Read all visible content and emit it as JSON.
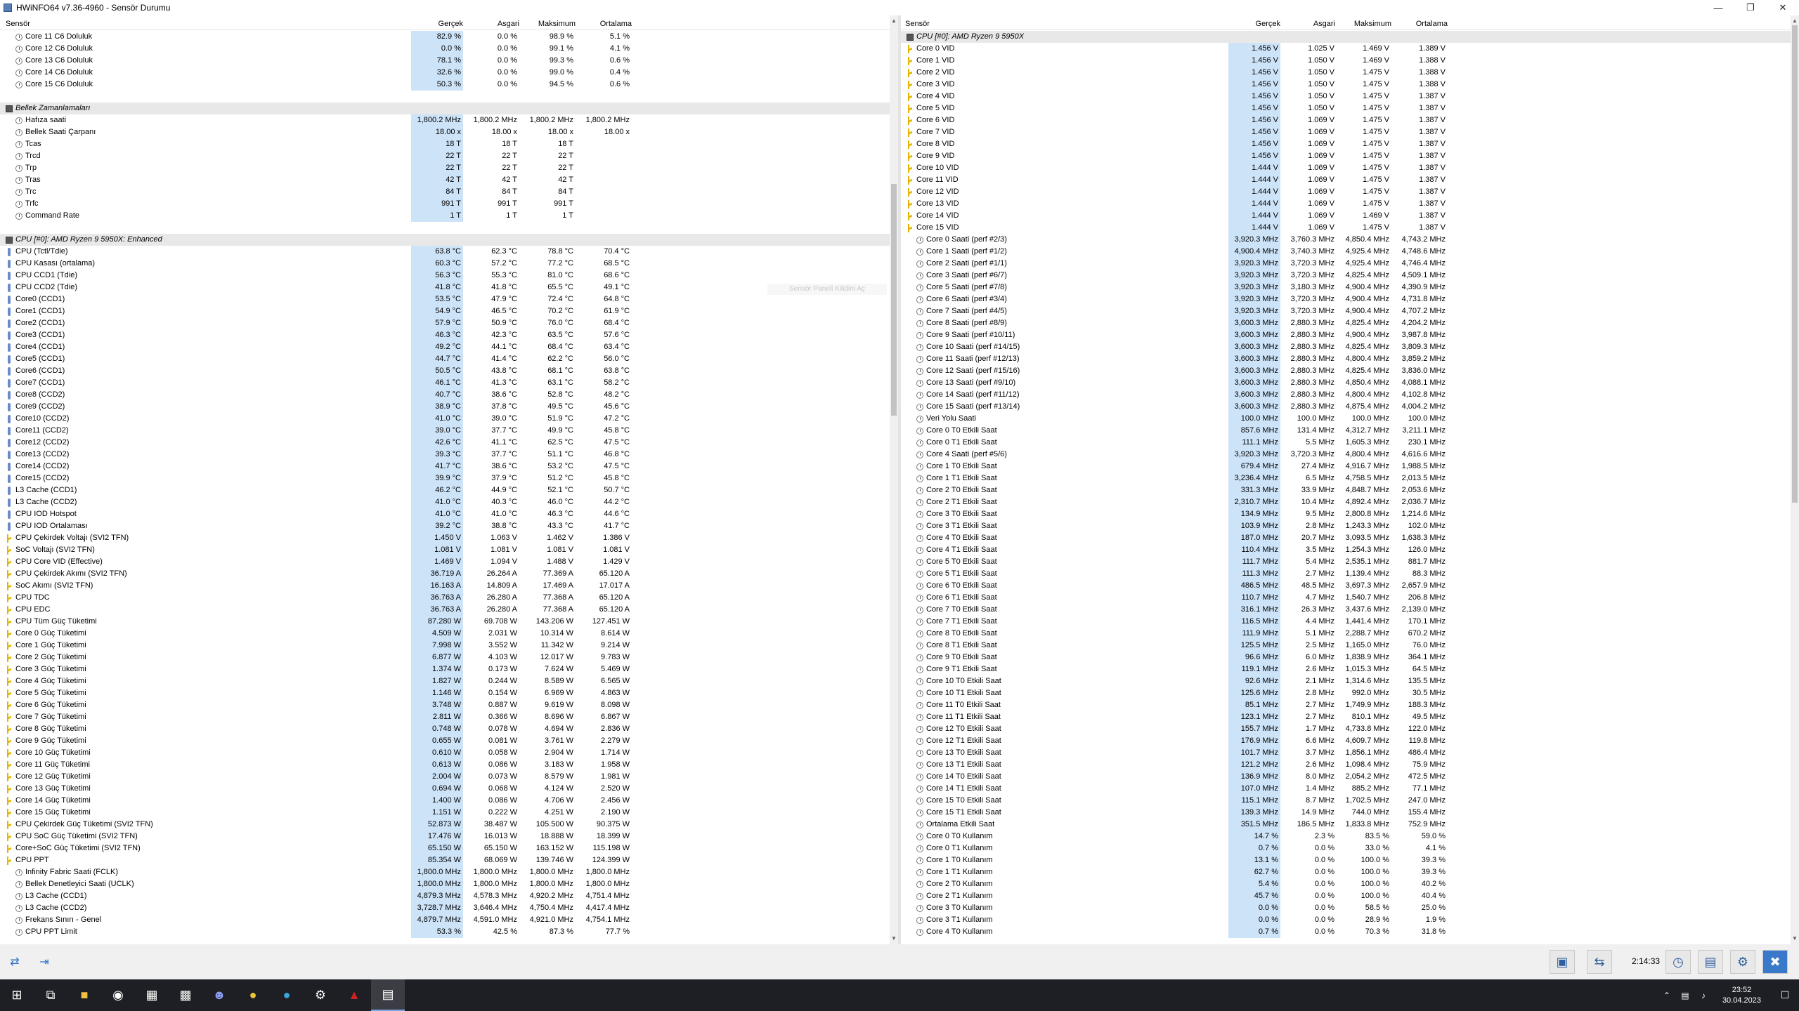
{
  "window": {
    "title": "HWiNFO64 v7.36-4960 - Sensör Durumu"
  },
  "columns": {
    "sensor": "Sensör",
    "current": "Gerçek",
    "min": "Asgari",
    "max": "Maksimum",
    "avg": "Ortalama"
  },
  "left_rows": [
    [
      "s",
      "Core 11 C6 Doluluk",
      "82.9 %",
      "0.0 %",
      "98.9 %",
      "5.1 %"
    ],
    [
      "s",
      "Core 12 C6 Doluluk",
      "0.0 %",
      "0.0 %",
      "99.1 %",
      "4.1 %"
    ],
    [
      "s",
      "Core 13 C6 Doluluk",
      "78.1 %",
      "0.0 %",
      "99.3 %",
      "0.6 %"
    ],
    [
      "s",
      "Core 14 C6 Doluluk",
      "32.6 %",
      "0.0 %",
      "99.0 %",
      "0.4 %"
    ],
    [
      "s",
      "Core 15 C6 Doluluk",
      "50.3 %",
      "0.0 %",
      "94.5 %",
      "0.6 %"
    ],
    [
      "gap"
    ],
    [
      "g",
      "Bellek Zamanlamaları"
    ],
    [
      "s",
      "Hafıza saati",
      "1,800.2 MHz",
      "1,800.2 MHz",
      "1,800.2 MHz",
      "1,800.2 MHz"
    ],
    [
      "s",
      "Bellek Saati Çarpanı",
      "18.00 x",
      "18.00 x",
      "18.00 x",
      "18.00 x"
    ],
    [
      "s",
      "Tcas",
      "18 T",
      "18 T",
      "18 T",
      ""
    ],
    [
      "s",
      "Trcd",
      "22 T",
      "22 T",
      "22 T",
      ""
    ],
    [
      "s",
      "Trp",
      "22 T",
      "22 T",
      "22 T",
      ""
    ],
    [
      "s",
      "Tras",
      "42 T",
      "42 T",
      "42 T",
      ""
    ],
    [
      "s",
      "Trc",
      "84 T",
      "84 T",
      "84 T",
      ""
    ],
    [
      "s",
      "Trfc",
      "991 T",
      "991 T",
      "991 T",
      ""
    ],
    [
      "s",
      "Command Rate",
      "1 T",
      "1 T",
      "1 T",
      ""
    ],
    [
      "gap"
    ],
    [
      "g",
      "CPU [#0]: AMD Ryzen 9 5950X: Enhanced"
    ],
    [
      "t",
      "CPU (Tctl/Tdie)",
      "63.8 °C",
      "62.3 °C",
      "78.8 °C",
      "70.4 °C"
    ],
    [
      "t",
      "CPU Kasası (ortalama)",
      "60.3 °C",
      "57.2 °C",
      "77.2 °C",
      "68.5 °C"
    ],
    [
      "t",
      "CPU CCD1 (Tdie)",
      "56.3 °C",
      "55.3 °C",
      "81.0 °C",
      "68.6 °C"
    ],
    [
      "t",
      "CPU CCD2 (Tdie)",
      "41.8 °C",
      "41.8 °C",
      "65.5 °C",
      "49.1 °C"
    ],
    [
      "t",
      "Core0 (CCD1)",
      "53.5 °C",
      "47.9 °C",
      "72.4 °C",
      "64.8 °C"
    ],
    [
      "t",
      "Core1 (CCD1)",
      "54.9 °C",
      "46.5 °C",
      "70.2 °C",
      "61.9 °C"
    ],
    [
      "t",
      "Core2 (CCD1)",
      "57.9 °C",
      "50.9 °C",
      "76.0 °C",
      "68.4 °C"
    ],
    [
      "t",
      "Core3 (CCD1)",
      "46.3 °C",
      "42.3 °C",
      "63.5 °C",
      "57.6 °C"
    ],
    [
      "t",
      "Core4 (CCD1)",
      "49.2 °C",
      "44.1 °C",
      "68.4 °C",
      "63.4 °C"
    ],
    [
      "t",
      "Core5 (CCD1)",
      "44.7 °C",
      "41.4 °C",
      "62.2 °C",
      "56.0 °C"
    ],
    [
      "t",
      "Core6 (CCD1)",
      "50.5 °C",
      "43.8 °C",
      "68.1 °C",
      "63.8 °C"
    ],
    [
      "t",
      "Core7 (CCD1)",
      "46.1 °C",
      "41.3 °C",
      "63.1 °C",
      "58.2 °C"
    ],
    [
      "t",
      "Core8 (CCD2)",
      "40.7 °C",
      "38.6 °C",
      "52.8 °C",
      "48.2 °C"
    ],
    [
      "t",
      "Core9 (CCD2)",
      "38.9 °C",
      "37.8 °C",
      "49.5 °C",
      "45.6 °C"
    ],
    [
      "t",
      "Core10 (CCD2)",
      "41.0 °C",
      "39.0 °C",
      "51.9 °C",
      "47.2 °C"
    ],
    [
      "t",
      "Core11 (CCD2)",
      "39.0 °C",
      "37.7 °C",
      "49.9 °C",
      "45.8 °C"
    ],
    [
      "t",
      "Core12 (CCD2)",
      "42.6 °C",
      "41.1 °C",
      "62.5 °C",
      "47.5 °C"
    ],
    [
      "t",
      "Core13 (CCD2)",
      "39.3 °C",
      "37.7 °C",
      "51.1 °C",
      "46.8 °C"
    ],
    [
      "t",
      "Core14 (CCD2)",
      "41.7 °C",
      "38.6 °C",
      "53.2 °C",
      "47.5 °C"
    ],
    [
      "t",
      "Core15 (CCD2)",
      "39.9 °C",
      "37.9 °C",
      "51.2 °C",
      "45.8 °C"
    ],
    [
      "t",
      "L3 Cache (CCD1)",
      "46.2 °C",
      "44.9 °C",
      "52.1 °C",
      "50.7 °C"
    ],
    [
      "t",
      "L3 Cache (CCD2)",
      "41.0 °C",
      "40.3 °C",
      "46.0 °C",
      "44.2 °C"
    ],
    [
      "t",
      "CPU IOD Hotspot",
      "41.0 °C",
      "41.0 °C",
      "46.3 °C",
      "44.6 °C"
    ],
    [
      "t",
      "CPU IOD Ortalaması",
      "39.2 °C",
      "38.8 °C",
      "43.3 °C",
      "41.7 °C"
    ],
    [
      "v",
      "CPU Çekirdek Voltajı (SVI2 TFN)",
      "1.450 V",
      "1.063 V",
      "1.462 V",
      "1.386 V"
    ],
    [
      "v",
      "SoC Voltajı (SVI2 TFN)",
      "1.081 V",
      "1.081 V",
      "1.081 V",
      "1.081 V"
    ],
    [
      "v",
      "CPU Core VID (Effective)",
      "1.469 V",
      "1.094 V",
      "1.488 V",
      "1.429 V"
    ],
    [
      "v",
      "CPU Çekirdek Akımı (SVI2 TFN)",
      "36.719 A",
      "26.264 A",
      "77.369 A",
      "65.120 A"
    ],
    [
      "v",
      "SoC Akımı (SVI2 TFN)",
      "16.163 A",
      "14.809 A",
      "17.469 A",
      "17.017 A"
    ],
    [
      "v",
      "CPU TDC",
      "36.763 A",
      "26.280 A",
      "77.368 A",
      "65.120 A"
    ],
    [
      "v",
      "CPU EDC",
      "36.763 A",
      "26.280 A",
      "77.368 A",
      "65.120 A"
    ],
    [
      "v",
      "CPU Tüm Güç Tüketimi",
      "87.280 W",
      "69.708 W",
      "143.206 W",
      "127.451 W"
    ],
    [
      "v",
      "Core 0 Güç Tüketimi",
      "4.509 W",
      "2.031 W",
      "10.314 W",
      "8.614 W"
    ],
    [
      "v",
      "Core 1 Güç Tüketimi",
      "7.998 W",
      "3.552 W",
      "11.342 W",
      "9.214 W"
    ],
    [
      "v",
      "Core 2 Güç Tüketimi",
      "6.877 W",
      "4.103 W",
      "12.017 W",
      "9.783 W"
    ],
    [
      "v",
      "Core 3 Güç Tüketimi",
      "1.374 W",
      "0.173 W",
      "7.624 W",
      "5.469 W"
    ],
    [
      "v",
      "Core 4 Güç Tüketimi",
      "1.827 W",
      "0.244 W",
      "8.589 W",
      "6.565 W"
    ],
    [
      "v",
      "Core 5 Güç Tüketimi",
      "1.146 W",
      "0.154 W",
      "6.969 W",
      "4.863 W"
    ],
    [
      "v",
      "Core 6 Güç Tüketimi",
      "3.748 W",
      "0.887 W",
      "9.619 W",
      "8.098 W"
    ],
    [
      "v",
      "Core 7 Güç Tüketimi",
      "2.811 W",
      "0.366 W",
      "8.696 W",
      "6.867 W"
    ],
    [
      "v",
      "Core 8 Güç Tüketimi",
      "0.748 W",
      "0.078 W",
      "4.694 W",
      "2.836 W"
    ],
    [
      "v",
      "Core 9 Güç Tüketimi",
      "0.655 W",
      "0.081 W",
      "3.761 W",
      "2.279 W"
    ],
    [
      "v",
      "Core 10 Güç Tüketimi",
      "0.610 W",
      "0.058 W",
      "2.904 W",
      "1.714 W"
    ],
    [
      "v",
      "Core 11 Güç Tüketimi",
      "0.613 W",
      "0.086 W",
      "3.183 W",
      "1.958 W"
    ],
    [
      "v",
      "Core 12 Güç Tüketimi",
      "2.004 W",
      "0.073 W",
      "8.579 W",
      "1.981 W"
    ],
    [
      "v",
      "Core 13 Güç Tüketimi",
      "0.694 W",
      "0.068 W",
      "4.124 W",
      "2.520 W"
    ],
    [
      "v",
      "Core 14 Güç Tüketimi",
      "1.400 W",
      "0.086 W",
      "4.706 W",
      "2.456 W"
    ],
    [
      "v",
      "Core 15 Güç Tüketimi",
      "1.151 W",
      "0.222 W",
      "4.251 W",
      "2.190 W"
    ],
    [
      "v",
      "CPU Çekirdek Güç Tüketimi (SVI2 TFN)",
      "52.873 W",
      "38.487 W",
      "105.500 W",
      "90.375 W"
    ],
    [
      "v",
      "CPU SoC Güç Tüketimi (SVI2 TFN)",
      "17.476 W",
      "16.013 W",
      "18.888 W",
      "18.399 W"
    ],
    [
      "v",
      "Core+SoC Güç Tüketimi (SVI2 TFN)",
      "65.150 W",
      "65.150 W",
      "163.152 W",
      "115.198 W"
    ],
    [
      "v",
      "CPU PPT",
      "85.354 W",
      "68.069 W",
      "139.746 W",
      "124.399 W"
    ],
    [
      "s",
      "Infinity Fabric Saati (FCLK)",
      "1,800.0 MHz",
      "1,800.0 MHz",
      "1,800.0 MHz",
      "1,800.0 MHz"
    ],
    [
      "s",
      "Bellek Denetleyici Saati (UCLK)",
      "1,800.0 MHz",
      "1,800.0 MHz",
      "1,800.0 MHz",
      "1,800.0 MHz"
    ],
    [
      "s",
      "L3 Cache (CCD1)",
      "4,879.3 MHz",
      "4,578.3 MHz",
      "4,920.2 MHz",
      "4,751.4 MHz"
    ],
    [
      "s",
      "L3 Cache (CCD2)",
      "3,728.7 MHz",
      "3,646.4 MHz",
      "4,750.4 MHz",
      "4,417.4 MHz"
    ],
    [
      "s",
      "Frekans Sınırı - Genel",
      "4,879.7 MHz",
      "4,591.0 MHz",
      "4,921.0 MHz",
      "4,754.1 MHz"
    ],
    [
      "s",
      "CPU PPT Limit",
      "53.3 %",
      "42.5 %",
      "87.3 %",
      "77.7 %"
    ]
  ],
  "right_rows": [
    [
      "g",
      "CPU [#0]: AMD Ryzen 9 5950X"
    ],
    [
      "v",
      "Core 0 VID",
      "1.456 V",
      "1.025 V",
      "1.469 V",
      "1.389 V"
    ],
    [
      "v",
      "Core 1 VID",
      "1.456 V",
      "1.050 V",
      "1.469 V",
      "1.388 V"
    ],
    [
      "v",
      "Core 2 VID",
      "1.456 V",
      "1.050 V",
      "1.475 V",
      "1.388 V"
    ],
    [
      "v",
      "Core 3 VID",
      "1.456 V",
      "1.050 V",
      "1.475 V",
      "1.388 V"
    ],
    [
      "v",
      "Core 4 VID",
      "1.456 V",
      "1.050 V",
      "1.475 V",
      "1.387 V"
    ],
    [
      "v",
      "Core 5 VID",
      "1.456 V",
      "1.050 V",
      "1.475 V",
      "1.387 V"
    ],
    [
      "v",
      "Core 6 VID",
      "1.456 V",
      "1.069 V",
      "1.475 V",
      "1.387 V"
    ],
    [
      "v",
      "Core 7 VID",
      "1.456 V",
      "1.069 V",
      "1.475 V",
      "1.387 V"
    ],
    [
      "v",
      "Core 8 VID",
      "1.456 V",
      "1.069 V",
      "1.475 V",
      "1.387 V"
    ],
    [
      "v",
      "Core 9 VID",
      "1.456 V",
      "1.069 V",
      "1.475 V",
      "1.387 V"
    ],
    [
      "v",
      "Core 10 VID",
      "1.444 V",
      "1.069 V",
      "1.475 V",
      "1.387 V"
    ],
    [
      "v",
      "Core 11 VID",
      "1.444 V",
      "1.069 V",
      "1.475 V",
      "1.387 V"
    ],
    [
      "v",
      "Core 12 VID",
      "1.444 V",
      "1.069 V",
      "1.475 V",
      "1.387 V"
    ],
    [
      "v",
      "Core 13 VID",
      "1.444 V",
      "1.069 V",
      "1.475 V",
      "1.387 V"
    ],
    [
      "v",
      "Core 14 VID",
      "1.444 V",
      "1.069 V",
      "1.469 V",
      "1.387 V"
    ],
    [
      "v",
      "Core 15 VID",
      "1.444 V",
      "1.069 V",
      "1.475 V",
      "1.387 V"
    ],
    [
      "s",
      "Core 0 Saati (perf #2/3)",
      "3,920.3 MHz",
      "3,760.3 MHz",
      "4,850.4 MHz",
      "4,743.2 MHz"
    ],
    [
      "s",
      "Core 1 Saati (perf #1/2)",
      "4,900.4 MHz",
      "3,740.3 MHz",
      "4,925.4 MHz",
      "4,748.6 MHz"
    ],
    [
      "s",
      "Core 2 Saati (perf #1/1)",
      "3,920.3 MHz",
      "3,720.3 MHz",
      "4,925.4 MHz",
      "4,746.4 MHz"
    ],
    [
      "s",
      "Core 3 Saati (perf #6/7)",
      "3,920.3 MHz",
      "3,720.3 MHz",
      "4,825.4 MHz",
      "4,509.1 MHz"
    ],
    [
      "s",
      "Core 5 Saati (perf #7/8)",
      "3,920.3 MHz",
      "3,180.3 MHz",
      "4,900.4 MHz",
      "4,390.9 MHz"
    ],
    [
      "s",
      "Core 6 Saati (perf #3/4)",
      "3,920.3 MHz",
      "3,720.3 MHz",
      "4,900.4 MHz",
      "4,731.8 MHz"
    ],
    [
      "s",
      "Core 7 Saati (perf #4/5)",
      "3,920.3 MHz",
      "3,720.3 MHz",
      "4,900.4 MHz",
      "4,707.2 MHz"
    ],
    [
      "s",
      "Core 8 Saati (perf #8/9)",
      "3,600.3 MHz",
      "2,880.3 MHz",
      "4,825.4 MHz",
      "4,204.2 MHz"
    ],
    [
      "s",
      "Core 9 Saati (perf #10/11)",
      "3,600.3 MHz",
      "2,880.3 MHz",
      "4,900.4 MHz",
      "3,987.8 MHz"
    ],
    [
      "s",
      "Core 10 Saati (perf #14/15)",
      "3,600.3 MHz",
      "2,880.3 MHz",
      "4,825.4 MHz",
      "3,809.3 MHz"
    ],
    [
      "s",
      "Core 11 Saati (perf #12/13)",
      "3,600.3 MHz",
      "2,880.3 MHz",
      "4,800.4 MHz",
      "3,859.2 MHz"
    ],
    [
      "s",
      "Core 12 Saati (perf #15/16)",
      "3,600.3 MHz",
      "2,880.3 MHz",
      "4,825.4 MHz",
      "3,836.0 MHz"
    ],
    [
      "s",
      "Core 13 Saati (perf #9/10)",
      "3,600.3 MHz",
      "2,880.3 MHz",
      "4,850.4 MHz",
      "4,088.1 MHz"
    ],
    [
      "s",
      "Core 14 Saati (perf #11/12)",
      "3,600.3 MHz",
      "2,880.3 MHz",
      "4,800.4 MHz",
      "4,102.8 MHz"
    ],
    [
      "s",
      "Core 15 Saati (perf #13/14)",
      "3,600.3 MHz",
      "2,880.3 MHz",
      "4,875.4 MHz",
      "4,004.2 MHz"
    ],
    [
      "s",
      "Veri Yolu Saati",
      "100.0 MHz",
      "100.0 MHz",
      "100.0 MHz",
      "100.0 MHz"
    ],
    [
      "s",
      "Core 0 T0 Etkili Saat",
      "857.6 MHz",
      "131.4 MHz",
      "4,312.7 MHz",
      "3,211.1 MHz"
    ],
    [
      "s",
      "Core 0 T1 Etkili Saat",
      "111.1 MHz",
      "5.5 MHz",
      "1,605.3 MHz",
      "230.1 MHz"
    ],
    [
      "s",
      "Core 4 Saati (perf #5/6)",
      "3,920.3 MHz",
      "3,720.3 MHz",
      "4,800.4 MHz",
      "4,616.6 MHz"
    ],
    [
      "s",
      "Core 1 T0 Etkili Saat",
      "679.4 MHz",
      "27.4 MHz",
      "4,916.7 MHz",
      "1,988.5 MHz"
    ],
    [
      "s",
      "Core 1 T1 Etkili Saat",
      "3,236.4 MHz",
      "6.5 MHz",
      "4,758.5 MHz",
      "2,013.5 MHz"
    ],
    [
      "s",
      "Core 2 T0 Etkili Saat",
      "331.3 MHz",
      "33.9 MHz",
      "4,848.7 MHz",
      "2,053.6 MHz"
    ],
    [
      "s",
      "Core 2 T1 Etkili Saat",
      "2,310.7 MHz",
      "10.4 MHz",
      "4,892.4 MHz",
      "2,036.7 MHz"
    ],
    [
      "s",
      "Core 3 T0 Etkili Saat",
      "134.9 MHz",
      "9.5 MHz",
      "2,800.8 MHz",
      "1,214.6 MHz"
    ],
    [
      "s",
      "Core 3 T1 Etkili Saat",
      "103.9 MHz",
      "2.8 MHz",
      "1,243.3 MHz",
      "102.0 MHz"
    ],
    [
      "s",
      "Core 4 T0 Etkili Saat",
      "187.0 MHz",
      "20.7 MHz",
      "3,093.5 MHz",
      "1,638.3 MHz"
    ],
    [
      "s",
      "Core 4 T1 Etkili Saat",
      "110.4 MHz",
      "3.5 MHz",
      "1,254.3 MHz",
      "126.0 MHz"
    ],
    [
      "s",
      "Core 5 T0 Etkili Saat",
      "111.7 MHz",
      "5.4 MHz",
      "2,535.1 MHz",
      "881.7 MHz"
    ],
    [
      "s",
      "Core 5 T1 Etkili Saat",
      "111.3 MHz",
      "2.7 MHz",
      "1,139.4 MHz",
      "88.3 MHz"
    ],
    [
      "s",
      "Core 6 T0 Etkili Saat",
      "486.5 MHz",
      "48.5 MHz",
      "3,697.3 MHz",
      "2,657.9 MHz"
    ],
    [
      "s",
      "Core 6 T1 Etkili Saat",
      "110.7 MHz",
      "4.7 MHz",
      "1,540.7 MHz",
      "206.8 MHz"
    ],
    [
      "s",
      "Core 7 T0 Etkili Saat",
      "316.1 MHz",
      "26.3 MHz",
      "3,437.6 MHz",
      "2,139.0 MHz"
    ],
    [
      "s",
      "Core 7 T1 Etkili Saat",
      "116.5 MHz",
      "4.4 MHz",
      "1,441.4 MHz",
      "170.1 MHz"
    ],
    [
      "s",
      "Core 8 T0 Etkili Saat",
      "111.9 MHz",
      "5.1 MHz",
      "2,288.7 MHz",
      "670.2 MHz"
    ],
    [
      "s",
      "Core 8 T1 Etkili Saat",
      "125.5 MHz",
      "2.5 MHz",
      "1,165.0 MHz",
      "76.0 MHz"
    ],
    [
      "s",
      "Core 9 T0 Etkili Saat",
      "96.6 MHz",
      "6.0 MHz",
      "1,838.9 MHz",
      "364.1 MHz"
    ],
    [
      "s",
      "Core 9 T1 Etkili Saat",
      "119.1 MHz",
      "2.6 MHz",
      "1,015.3 MHz",
      "64.5 MHz"
    ],
    [
      "s",
      "Core 10 T0 Etkili Saat",
      "92.6 MHz",
      "2.1 MHz",
      "1,314.6 MHz",
      "135.5 MHz"
    ],
    [
      "s",
      "Core 10 T1 Etkili Saat",
      "125.6 MHz",
      "2.8 MHz",
      "992.0 MHz",
      "30.5 MHz"
    ],
    [
      "s",
      "Core 11 T0 Etkili Saat",
      "85.1 MHz",
      "2.7 MHz",
      "1,749.9 MHz",
      "188.3 MHz"
    ],
    [
      "s",
      "Core 11 T1 Etkili Saat",
      "123.1 MHz",
      "2.7 MHz",
      "810.1 MHz",
      "49.5 MHz"
    ],
    [
      "s",
      "Core 12 T0 Etkili Saat",
      "155.7 MHz",
      "1.7 MHz",
      "4,733.8 MHz",
      "122.0 MHz"
    ],
    [
      "s",
      "Core 12 T1 Etkili Saat",
      "176.9 MHz",
      "6.6 MHz",
      "4,609.7 MHz",
      "119.8 MHz"
    ],
    [
      "s",
      "Core 13 T0 Etkili Saat",
      "101.7 MHz",
      "3.7 MHz",
      "1,856.1 MHz",
      "486.4 MHz"
    ],
    [
      "s",
      "Core 13 T1 Etkili Saat",
      "121.2 MHz",
      "2.6 MHz",
      "1,098.4 MHz",
      "75.9 MHz"
    ],
    [
      "s",
      "Core 14 T0 Etkili Saat",
      "136.9 MHz",
      "8.0 MHz",
      "2,054.2 MHz",
      "472.5 MHz"
    ],
    [
      "s",
      "Core 14 T1 Etkili Saat",
      "107.0 MHz",
      "1.4 MHz",
      "885.2 MHz",
      "77.1 MHz"
    ],
    [
      "s",
      "Core 15 T0 Etkili Saat",
      "115.1 MHz",
      "8.7 MHz",
      "1,702.5 MHz",
      "247.0 MHz"
    ],
    [
      "s",
      "Core 15 T1 Etkili Saat",
      "139.3 MHz",
      "14.9 MHz",
      "744.0 MHz",
      "155.4 MHz"
    ],
    [
      "s",
      "Ortalama Etkili Saat",
      "351.5 MHz",
      "186.5 MHz",
      "1,833.8 MHz",
      "752.9 MHz"
    ],
    [
      "s",
      "Core 0 T0 Kullanım",
      "14.7 %",
      "2.3 %",
      "83.5 %",
      "59.0 %"
    ],
    [
      "s",
      "Core 0 T1 Kullanım",
      "0.7 %",
      "0.0 %",
      "33.0 %",
      "4.1 %"
    ],
    [
      "s",
      "Core 1 T0 Kullanım",
      "13.1 %",
      "0.0 %",
      "100.0 %",
      "39.3 %"
    ],
    [
      "s",
      "Core 1 T1 Kullanım",
      "62.7 %",
      "0.0 %",
      "100.0 %",
      "39.3 %"
    ],
    [
      "s",
      "Core 2 T0 Kullanım",
      "5.4 %",
      "0.0 %",
      "100.0 %",
      "40.2 %"
    ],
    [
      "s",
      "Core 2 T1 Kullanım",
      "45.7 %",
      "0.0 %",
      "100.0 %",
      "40.4 %"
    ],
    [
      "s",
      "Core 3 T0 Kullanım",
      "0.0 %",
      "0.0 %",
      "58.5 %",
      "25.0 %"
    ],
    [
      "s",
      "Core 3 T1 Kullanım",
      "0.0 %",
      "0.0 %",
      "28.9 %",
      "1.9 %"
    ],
    [
      "s",
      "Core 4 T0 Kullanım",
      "0.7 %",
      "0.0 %",
      "70.3 %",
      "31.8 %"
    ]
  ],
  "ghost_text": "Sensör Paneli Kilidini Aç",
  "toolbar": {
    "timer": "2:14:33"
  },
  "taskbar": {
    "time": "23:52",
    "date": "30.04.2023"
  }
}
